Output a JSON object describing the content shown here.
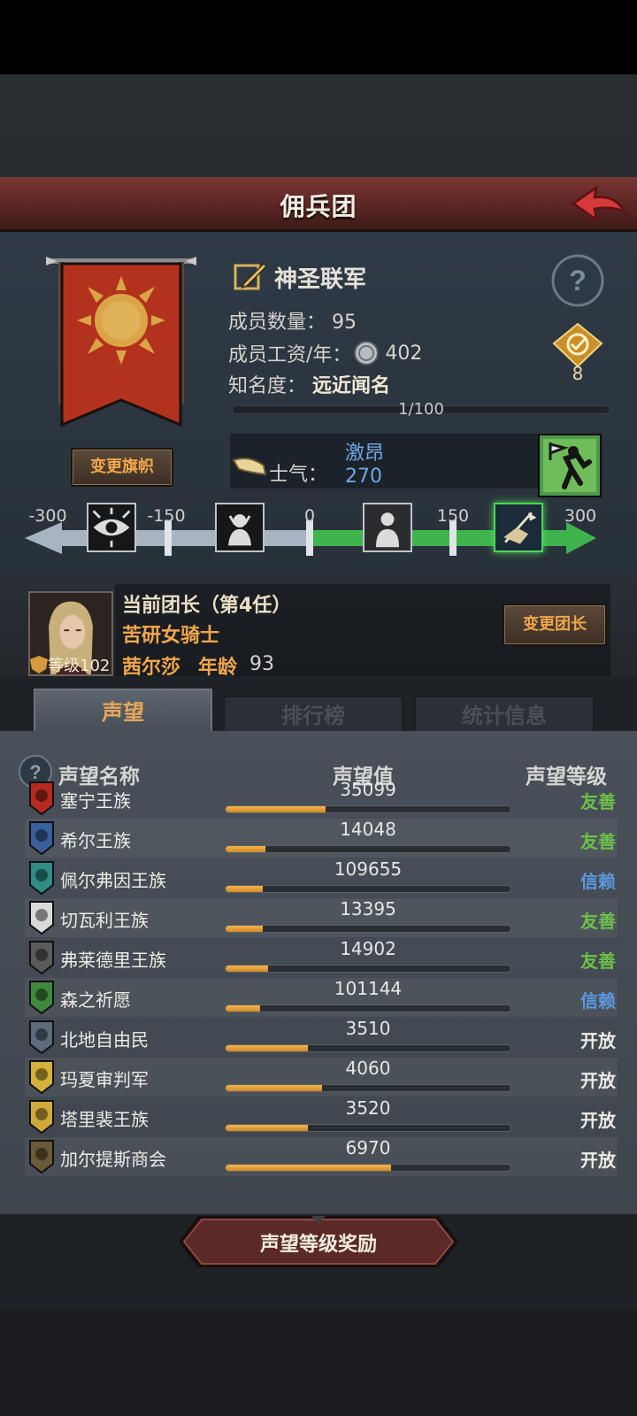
{
  "header": {
    "title": "佣兵团"
  },
  "guild": {
    "name": "神圣联军",
    "members_label": "成员数量：",
    "members_value": "95",
    "salary_label": "成员工资/年：",
    "salary_value": "402",
    "fame_label": "知名度：",
    "fame_value": "远近闻名",
    "fame_progress": "1/100",
    "rank_badge_number": "8",
    "change_flag_label": "变更旗帜"
  },
  "morale": {
    "label": "士气：",
    "state": "激昂",
    "value": "270",
    "scale_ticks": [
      "-300",
      "-150",
      "0",
      "150",
      "300"
    ]
  },
  "leader": {
    "title": "当前团长（第4任）",
    "class": "苦研女骑士",
    "name": "茜尔莎",
    "age_label": "年龄",
    "age_value": "93",
    "level_label": "等级102",
    "change_button_label": "变更团长"
  },
  "tabs": [
    {
      "label": "声望",
      "active": true
    },
    {
      "label": "排行榜",
      "active": false
    },
    {
      "label": "统计信息",
      "active": false
    }
  ],
  "reputation": {
    "columns": {
      "name": "声望名称",
      "value": "声望值",
      "level": "声望等级"
    },
    "rows": [
      {
        "name": "塞宁王族",
        "value": "35099",
        "fill": 0.35,
        "level": "友善",
        "level_color": "#6cc04a",
        "icon": "red-crest-icon"
      },
      {
        "name": "希尔王族",
        "value": "14048",
        "fill": 0.14,
        "level": "友善",
        "level_color": "#6cc04a",
        "icon": "blue-crest-icon"
      },
      {
        "name": "佩尔弗因王族",
        "value": "109655",
        "fill": 0.13,
        "level": "信赖",
        "level_color": "#5b98e0",
        "icon": "moon-crest-icon"
      },
      {
        "name": "切瓦利王族",
        "value": "13395",
        "fill": 0.13,
        "level": "友善",
        "level_color": "#6cc04a",
        "icon": "scales-crest-icon"
      },
      {
        "name": "弗莱德里王族",
        "value": "14902",
        "fill": 0.15,
        "level": "友善",
        "level_color": "#6cc04a",
        "icon": "mask-crest-icon"
      },
      {
        "name": "森之祈愿",
        "value": "101144",
        "fill": 0.12,
        "level": "信赖",
        "level_color": "#5b98e0",
        "icon": "tree-crest-icon"
      },
      {
        "name": "北地自由民",
        "value": "3510",
        "fill": 0.29,
        "level": "开放",
        "level_color": "#ecebe6",
        "icon": "horns-crest-icon"
      },
      {
        "name": "玛夏审判军",
        "value": "4060",
        "fill": 0.34,
        "level": "开放",
        "level_color": "#ecebe6",
        "icon": "cross-crest-icon"
      },
      {
        "name": "塔里裴王族",
        "value": "3520",
        "fill": 0.29,
        "level": "开放",
        "level_color": "#ecebe6",
        "icon": "crown-crest-icon"
      },
      {
        "name": "加尔提斯商会",
        "value": "6970",
        "fill": 0.58,
        "level": "开放",
        "level_color": "#ecebe6",
        "icon": "chest-crest-icon"
      }
    ]
  },
  "reward_button_label": "声望等级奖励",
  "colors": {
    "accent_orange": "#f1a64a",
    "friendly_green": "#6cc04a",
    "trust_blue": "#5b98e0",
    "header_red": "#5a2624"
  }
}
